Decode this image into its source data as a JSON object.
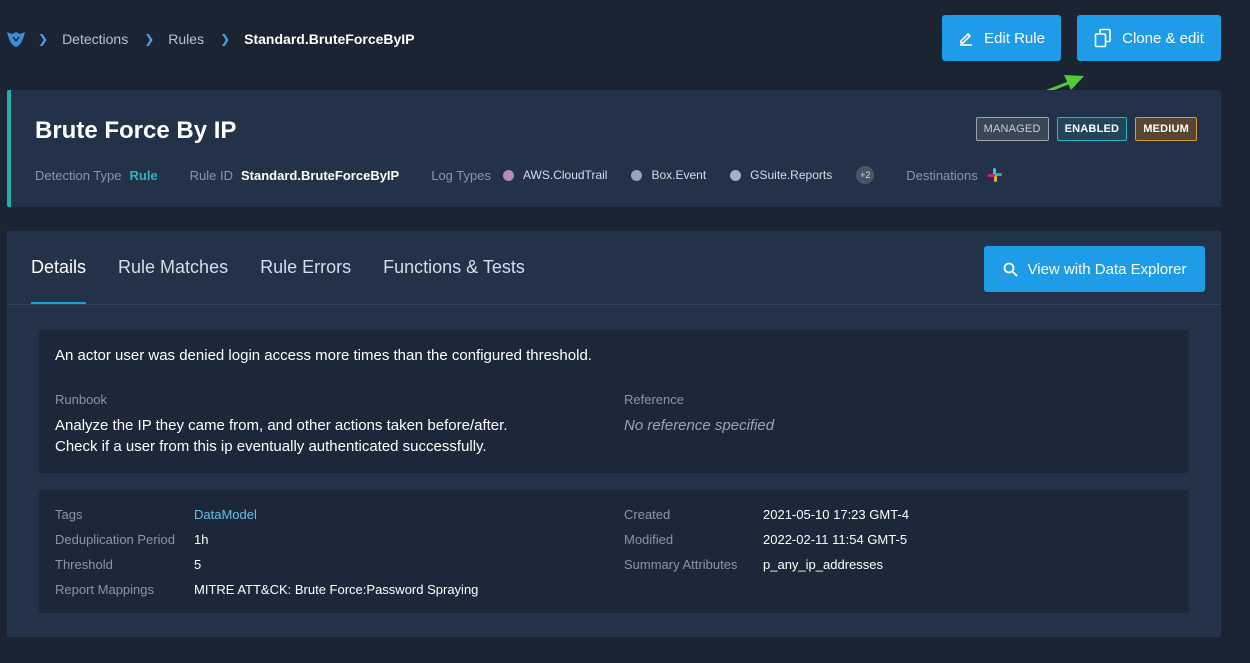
{
  "breadcrumb": {
    "items": [
      "Detections",
      "Rules"
    ],
    "current": "Standard.BruteForceByIP"
  },
  "actions": {
    "edit_label": "Edit Rule",
    "clone_label": "Clone & edit"
  },
  "header": {
    "title": "Brute Force By IP",
    "badges": {
      "managed": "MANAGED",
      "enabled": "ENABLED",
      "severity": "MEDIUM"
    },
    "detection_type_label": "Detection Type",
    "detection_type": "Rule",
    "rule_id_label": "Rule ID",
    "rule_id": "Standard.BruteForceByIP",
    "log_types_label": "Log Types",
    "log_types": [
      {
        "name": "AWS.CloudTrail",
        "color": "#b58bb8"
      },
      {
        "name": "Box.Event",
        "color": "#9aa4b8"
      },
      {
        "name": "GSuite.Reports",
        "color": "#a7acd8"
      }
    ],
    "log_types_more": "+2",
    "destinations_label": "Destinations",
    "destination_icon": "slack-icon"
  },
  "tabs": [
    {
      "label": "Details",
      "active": true
    },
    {
      "label": "Rule Matches",
      "active": false
    },
    {
      "label": "Rule Errors",
      "active": false
    },
    {
      "label": "Functions & Tests",
      "active": false
    }
  ],
  "explorer_button": "View with Data Explorer",
  "details": {
    "description": "An actor user was denied login access more times than the configured threshold.",
    "runbook_label": "Runbook",
    "runbook_line1": "Analyze the IP they came from, and other actions taken before/after.",
    "runbook_line2": "Check if a user from this ip eventually authenticated successfully.",
    "reference_label": "Reference",
    "reference": "No reference specified"
  },
  "attributes": {
    "tags_label": "Tags",
    "tags": "DataModel",
    "dedup_label": "Deduplication Period",
    "dedup": "1h",
    "threshold_label": "Threshold",
    "threshold": "5",
    "mappings_label": "Report Mappings",
    "mappings": "MITRE ATT&CK: Brute Force:Password Spraying",
    "created_label": "Created",
    "created": "2021-05-10 17:23 GMT-4",
    "modified_label": "Modified",
    "modified": "2022-02-11 11:54 GMT-5",
    "summary_label": "Summary Attributes",
    "summary": "p_any_ip_addresses"
  }
}
